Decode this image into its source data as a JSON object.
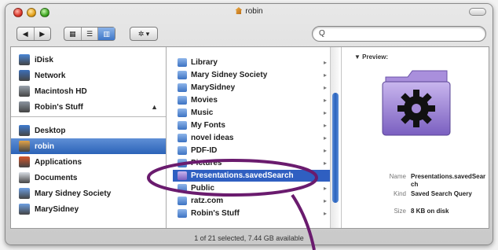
{
  "window": {
    "title": "robin",
    "status": "1 of 21 selected, 7.44 GB available"
  },
  "toolbar": {
    "back_label": "◀",
    "forward_label": "▶",
    "view_icon_label": "▦",
    "view_list_label": "☰",
    "view_column_label": "▥",
    "action_label": "✲ ▾",
    "search_value": "",
    "search_placeholder": ""
  },
  "sidebar": {
    "items": [
      {
        "label": "iDisk",
        "icon": "idisk-icon",
        "color": "#4a86d6"
      },
      {
        "label": "Network",
        "icon": "network-icon",
        "color": "#3c6fb8"
      },
      {
        "label": "Macintosh HD",
        "icon": "harddisk-icon",
        "color": "#9aa3ad"
      },
      {
        "label": "Robin's Stuff",
        "icon": "drive-icon",
        "color": "#8c95a0",
        "eject": "▲"
      },
      {
        "label": "Desktop",
        "icon": "desktop-icon",
        "color": "#3f7cd0"
      },
      {
        "label": "robin",
        "icon": "home-icon",
        "color": "#e2a34a",
        "selected": true
      },
      {
        "label": "Applications",
        "icon": "applications-icon",
        "color": "#d4552a"
      },
      {
        "label": "Documents",
        "icon": "documents-icon",
        "color": "#d8dde4"
      },
      {
        "label": "Mary Sidney Society",
        "icon": "folder-icon",
        "color": "#6d9fe2"
      },
      {
        "label": "MarySidney",
        "icon": "folder-icon",
        "color": "#6d9fe2"
      }
    ]
  },
  "column": {
    "items": [
      {
        "label": "Library",
        "icon": "folder-icon"
      },
      {
        "label": "Mary Sidney Society",
        "icon": "folder-icon"
      },
      {
        "label": "MarySidney",
        "icon": "folder-icon"
      },
      {
        "label": "Movies",
        "icon": "movies-folder-icon"
      },
      {
        "label": "Music",
        "icon": "music-folder-icon"
      },
      {
        "label": "My Fonts",
        "icon": "folder-icon"
      },
      {
        "label": "novel ideas",
        "icon": "folder-icon"
      },
      {
        "label": "PDF-ID",
        "icon": "folder-icon"
      },
      {
        "label": "Pictures",
        "icon": "pictures-folder-icon"
      },
      {
        "label": "Presentations.savedSearch",
        "icon": "smart-folder-icon",
        "selected": true
      },
      {
        "label": "Public",
        "icon": "public-folder-icon"
      },
      {
        "label": "ratz.com",
        "icon": "folder-icon"
      },
      {
        "label": "Robin's Stuff",
        "icon": "folder-icon"
      }
    ]
  },
  "preview": {
    "heading": "▼ Preview:",
    "name_key": "Name",
    "name_value": "Presentations.savedSearch",
    "kind_key": "Kind",
    "kind_value": "Saved Search Query",
    "size_key": "Size",
    "size_value": "8 KB on disk"
  },
  "colors": {
    "selection": "#2f5fc1",
    "annotation": "#6a1b6e"
  }
}
